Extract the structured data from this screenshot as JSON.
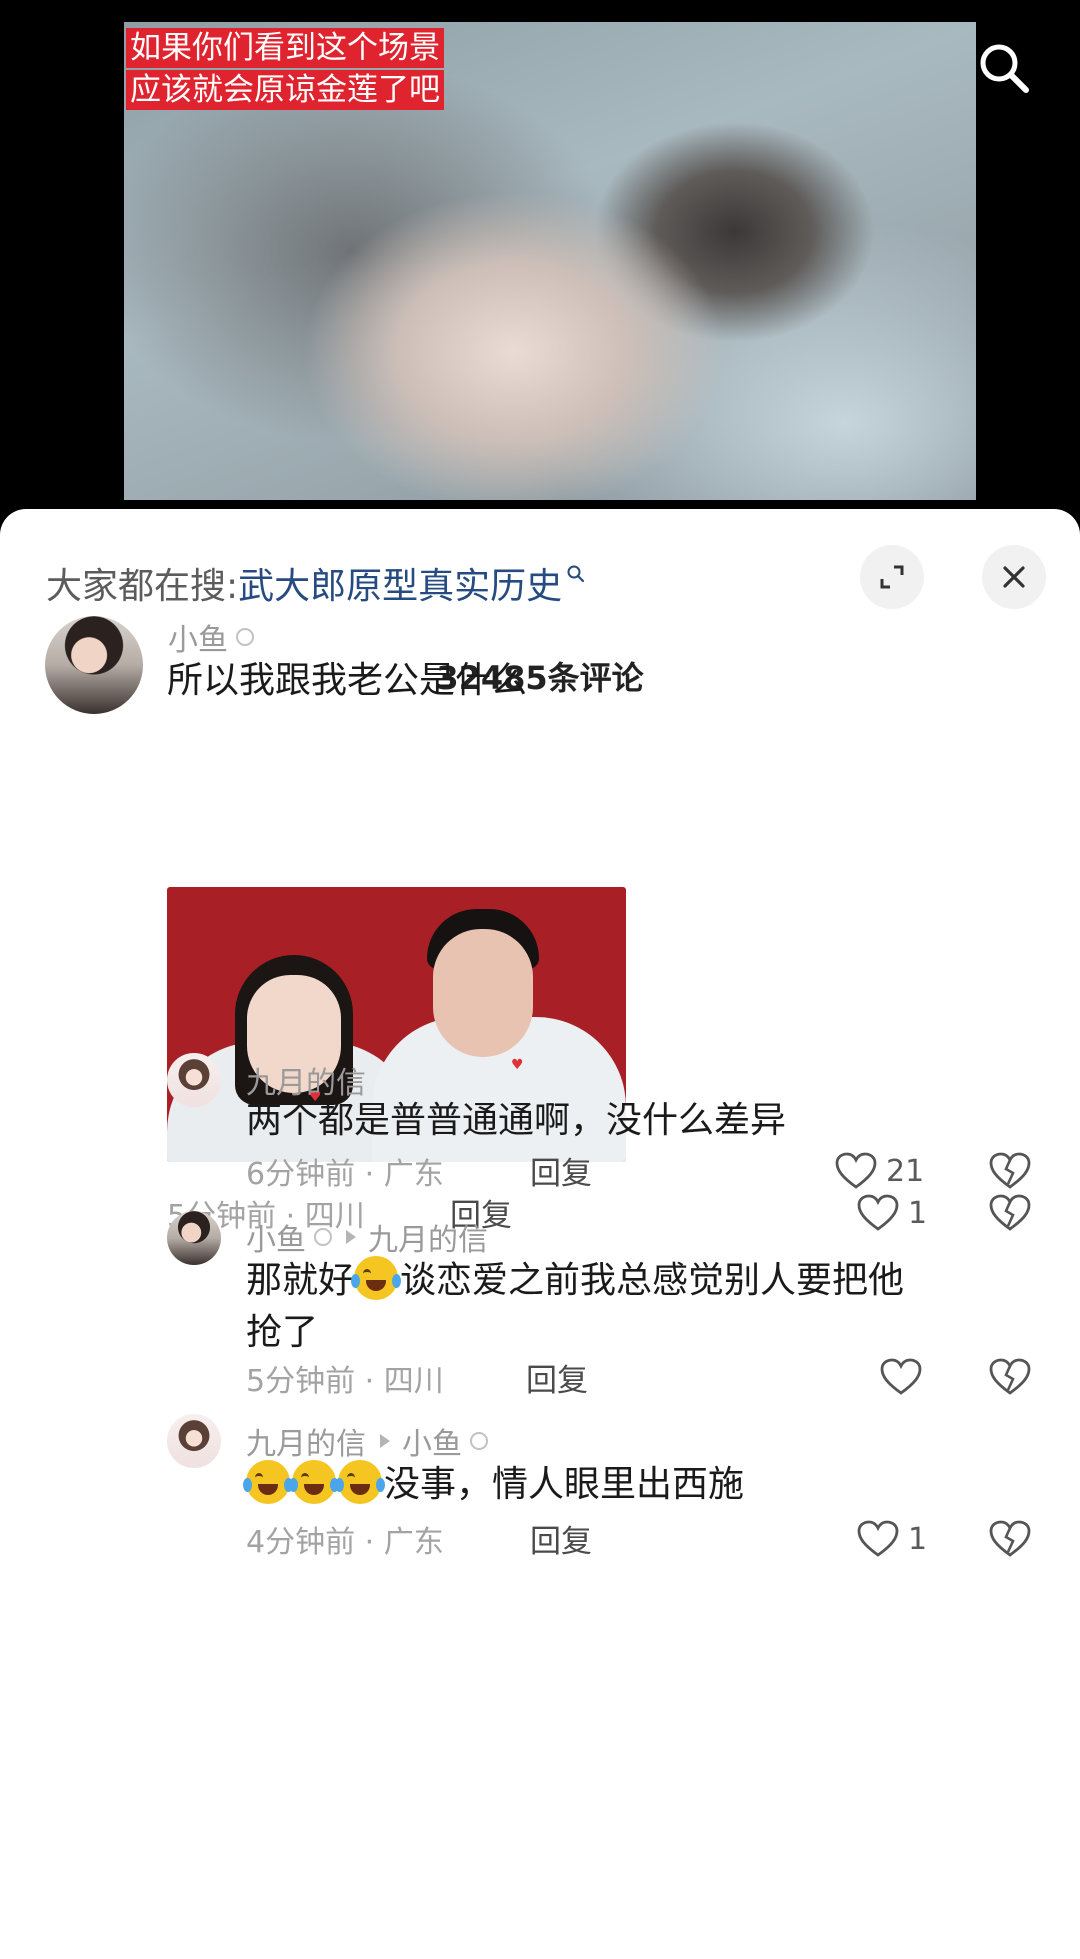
{
  "video": {
    "caption_line1": "如果你们看到这个场景",
    "caption_line2": "应该就会原谅金莲了吧",
    "search_icon": "search-icon"
  },
  "sheet": {
    "search_prefix": "大家都在搜:",
    "search_term": "武大郎原型真实历史",
    "comment_count": "32485条评论",
    "expand_icon": "expand-icon",
    "close_icon": "close-icon"
  },
  "comments": [
    {
      "user": "小鱼",
      "text": "所以我跟我老公是什么",
      "time_location": "5分钟前 · 四川",
      "reply_label": "回复",
      "likes": "1",
      "has_photo": true
    },
    {
      "user": "九月的信",
      "text": "两个都是普普通通啊，没什么差异",
      "time_location": "6分钟前 · 广东",
      "reply_label": "回复",
      "likes": "21"
    },
    {
      "user": "小鱼",
      "reply_to": "九月的信",
      "text_before_emoji": "那就好",
      "text_after_emoji": "谈恋爱之前我总感觉别人要把他",
      "text_line2": "抢了",
      "time_location": "5分钟前 · 四川",
      "reply_label": "回复"
    },
    {
      "user": "九月的信",
      "reply_to": "小鱼",
      "text_after_emoji": "没事，情人眼里出西施",
      "time_location": "4分钟前 · 广东",
      "reply_label": "回复",
      "likes": "1"
    }
  ],
  "icons": {
    "like": "heart-outline-icon",
    "dislike": "broken-heart-icon",
    "emoji_laugh_cry": "laughing-crying-emoji"
  }
}
